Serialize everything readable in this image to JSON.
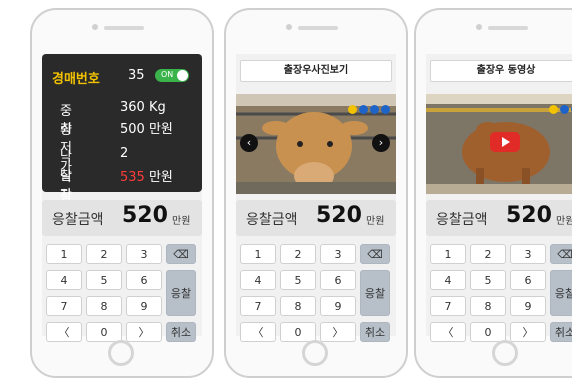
{
  "phone1": {
    "auction_label": "경매번호",
    "auction_number": "35",
    "toggle_label": "ON",
    "weight_label": "중량",
    "weight_value": "360 Kg",
    "min_price_label": "최저가",
    "min_price_value": "500 만원",
    "bidders_label": "낙찰자",
    "bidders_value": "2",
    "final_label": "낙찰가",
    "final_number": "535",
    "final_unit": " 만원"
  },
  "phone2": {
    "header": "출장우사진보기"
  },
  "phone3": {
    "header": "출장우 동영상"
  },
  "bid": {
    "label": "응찰금액",
    "value": "520",
    "unit": "만원"
  },
  "keypad": {
    "keys": [
      "1",
      "2",
      "3",
      "4",
      "5",
      "6",
      "7",
      "8",
      "9",
      "〈",
      "0",
      "〉"
    ],
    "backspace": "⌫",
    "bid_label": "응찰",
    "cancel_label": "취소"
  },
  "colors": {
    "dot1": "#f2c200",
    "dot2": "#1e64c8",
    "dot3": "#1e64c8",
    "dot4": "#1e64c8"
  }
}
